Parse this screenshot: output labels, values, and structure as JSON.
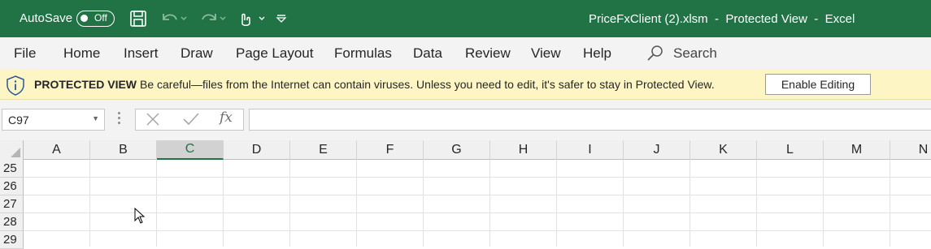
{
  "titlebar": {
    "autosave_label": "AutoSave",
    "autosave_state": "Off",
    "document_title": "PriceFxClient (2).xlsm  -  Protected View  -  Excel",
    "background_color": "#217346",
    "icons": [
      "save-icon",
      "undo-icon",
      "redo-icon",
      "touch-mode-icon",
      "customize-qat-icon"
    ]
  },
  "ribbon": {
    "tabs": [
      "File",
      "Home",
      "Insert",
      "Draw",
      "Page Layout",
      "Formulas",
      "Data",
      "Review",
      "View",
      "Help"
    ],
    "search_label": "Search"
  },
  "protected_view": {
    "title": "PROTECTED VIEW",
    "message": "Be careful—files from the Internet can contain viruses. Unless you need to edit, it's safer to stay in Protected View.",
    "button_label": "Enable Editing",
    "background_color": "#fdf6c4"
  },
  "formula_bar": {
    "name_box_value": "C97",
    "fx_label": "fx",
    "formula_value": ""
  },
  "grid": {
    "columns": [
      "A",
      "B",
      "C",
      "D",
      "E",
      "F",
      "G",
      "H",
      "I",
      "J",
      "K",
      "L",
      "M",
      "N"
    ],
    "selected_column": "C",
    "rows": [
      "25",
      "26",
      "27",
      "28",
      "29"
    ]
  }
}
